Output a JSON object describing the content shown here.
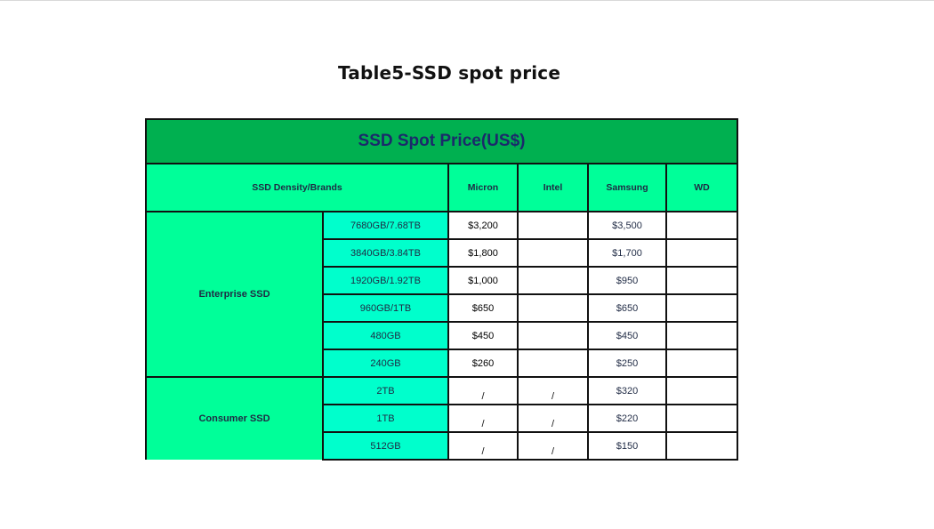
{
  "document": {
    "title": "Table5-SSD spot price"
  },
  "table": {
    "banner": "SSD Spot Price(US$)",
    "header": {
      "density_brands": "SSD Density/Brands",
      "brands": [
        "Micron",
        "Intel",
        "Samsung",
        "WD"
      ]
    },
    "groups": [
      {
        "category": "Enterprise SSD",
        "rows": [
          {
            "density": "7680GB/7.68TB",
            "micron": "$3,200",
            "intel": "",
            "samsung": "$3,500",
            "wd": ""
          },
          {
            "density": "3840GB/3.84TB",
            "micron": "$1,800",
            "intel": "",
            "samsung": "$1,700",
            "wd": ""
          },
          {
            "density": "1920GB/1.92TB",
            "micron": "$1,000",
            "intel": "",
            "samsung": "$950",
            "wd": ""
          },
          {
            "density": "960GB/1TB",
            "micron": "$650",
            "intel": "",
            "samsung": "$650",
            "wd": ""
          },
          {
            "density": "480GB",
            "micron": "$450",
            "intel": "",
            "samsung": "$450",
            "wd": ""
          },
          {
            "density": "240GB",
            "micron": "$260",
            "intel": "",
            "samsung": "$250",
            "wd": ""
          }
        ]
      },
      {
        "category": "Consumer SSD",
        "rows": [
          {
            "density": "2TB",
            "micron": "/",
            "intel": "/",
            "samsung": "$320",
            "wd": ""
          },
          {
            "density": "1TB",
            "micron": "/",
            "intel": "/",
            "samsung": "$220",
            "wd": ""
          },
          {
            "density": "512GB",
            "micron": "/",
            "intel": "/",
            "samsung": "$150",
            "wd": ""
          }
        ]
      }
    ]
  },
  "colors": {
    "banner_green": "#00b050",
    "header_green": "#00ff99",
    "density_cyan": "#00ffcc",
    "banner_text": "#1b2a6b"
  }
}
